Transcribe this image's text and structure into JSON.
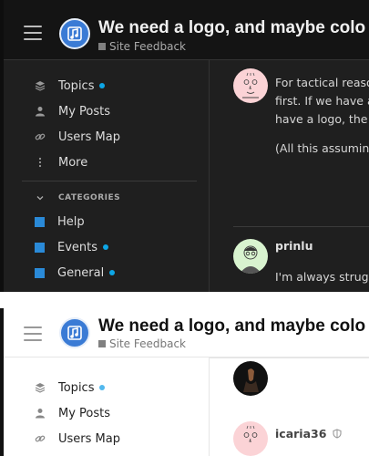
{
  "topic": {
    "title": "We need a logo, and maybe colo",
    "category": "Site Feedback",
    "category_color": "#808080"
  },
  "sidebar": {
    "items": [
      {
        "label": "Topics",
        "icon": "layers-icon",
        "unread": true
      },
      {
        "label": "My Posts",
        "icon": "user-icon",
        "unread": false
      },
      {
        "label": "Users Map",
        "icon": "link-icon",
        "unread": false
      },
      {
        "label": "More",
        "icon": "vertical-ellipsis-icon",
        "unread": false
      }
    ],
    "categories_heading": "CATEGORIES",
    "categories": [
      {
        "label": "Help",
        "color": "#2a8ad8",
        "unread": false
      },
      {
        "label": "Events",
        "color": "#2a8ad8",
        "unread": true
      },
      {
        "label": "General",
        "color": "#2a8ad8",
        "unread": true
      }
    ]
  },
  "posts_dark": {
    "first": {
      "lines": [
        "For tactical reaso",
        "first. If we have a",
        "have a logo, the w",
        "(All this assuming"
      ]
    },
    "second": {
      "username": "prinlu",
      "line": "I'm always strugg"
    }
  },
  "posts_light": {
    "second": {
      "username": "icaria36"
    }
  },
  "colors": {
    "unread_dot": "#0da6e6",
    "logo_blue": "#3a7bd5",
    "dark_bg": "#1f1f1f"
  }
}
